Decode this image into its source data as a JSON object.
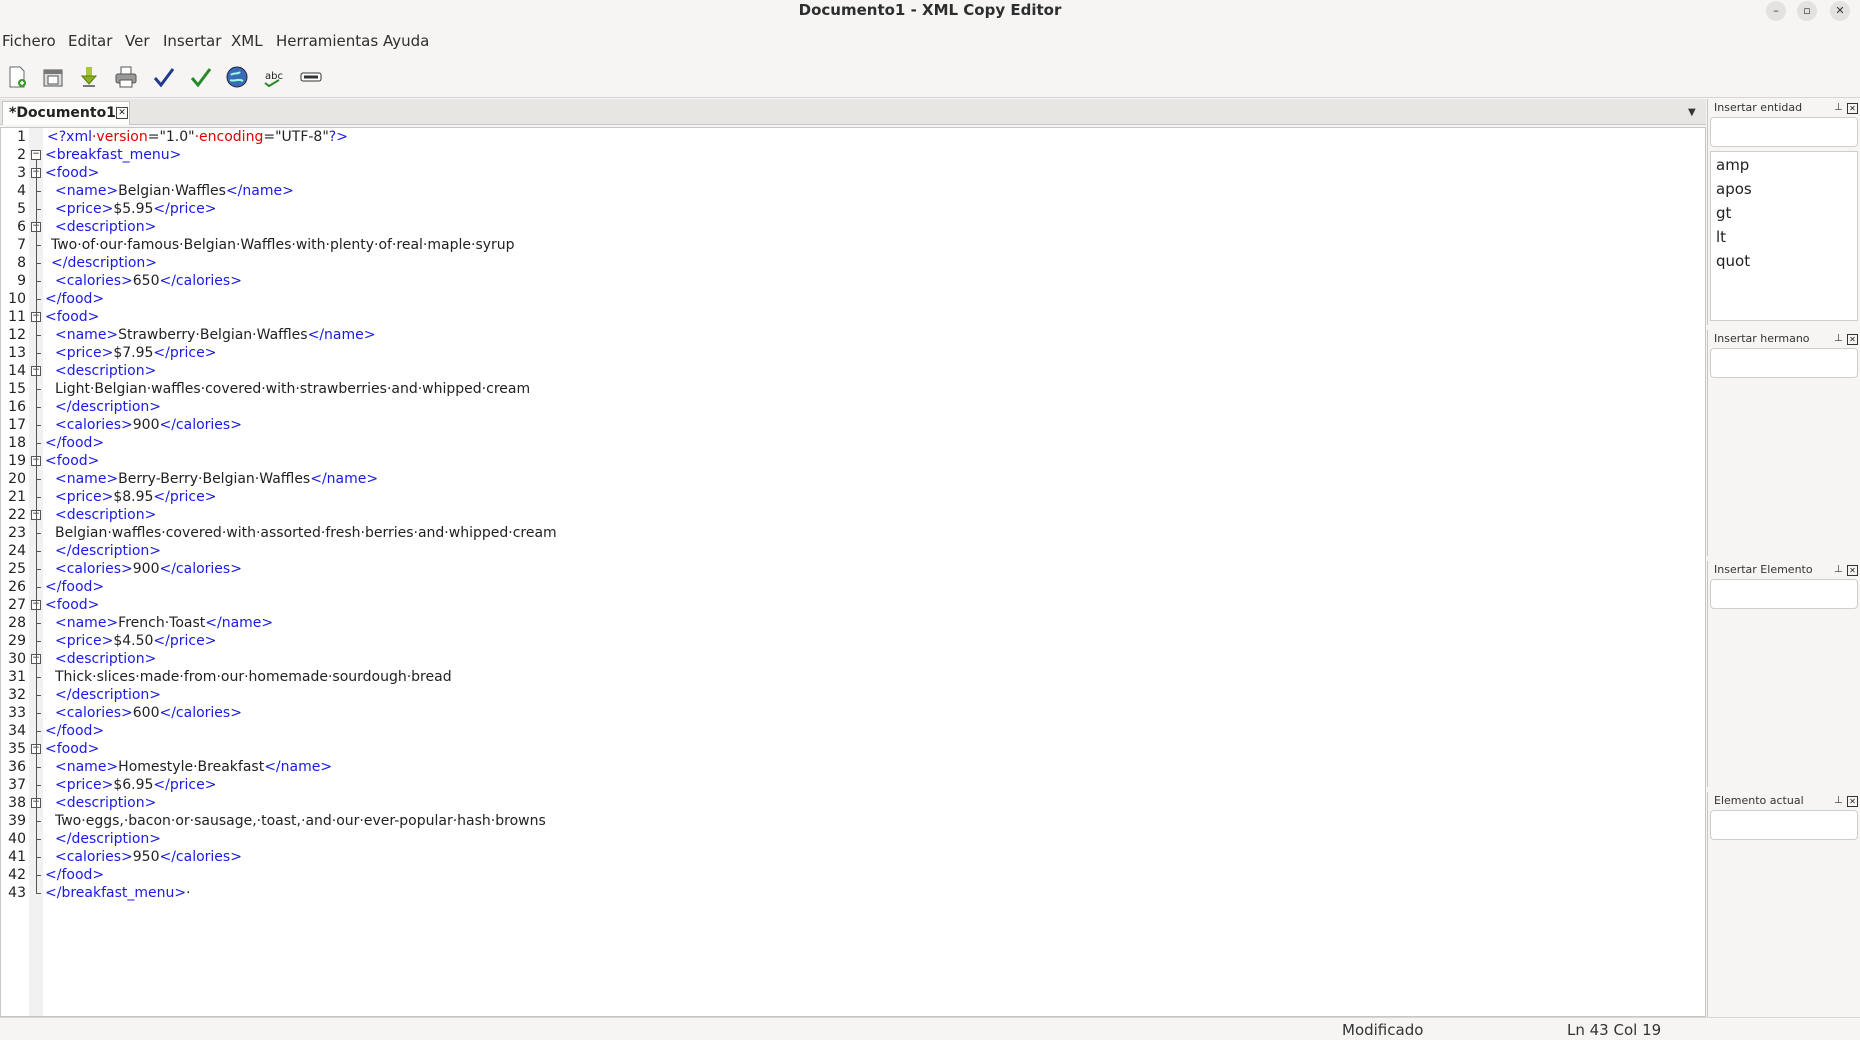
{
  "window": {
    "title": "Documento1 - XML Copy Editor"
  },
  "menubar": [
    "Fichero",
    "Editar",
    "Ver",
    "Insertar",
    "XML",
    "Herramientas",
    "Ayuda"
  ],
  "toolbar": [
    "new-document-icon",
    "open-icon",
    "save-icon",
    "print-icon",
    "check-wellformed-icon",
    "validate-icon",
    "browser-preview-icon",
    "spelling-icon",
    "hide-tags-icon"
  ],
  "tab": {
    "label": "*Documento1"
  },
  "editor": {
    "lines": [
      "<?xml version=\"1.0\" encoding=\"UTF-8\"?>",
      "<breakfast_menu>",
      "<food>",
      "<name>Belgian·Waffles</name>",
      "<price>$5.95</price>",
      "<description>",
      "Two·of·our·famous·Belgian·Waffles·with·plenty·of·real·maple·syrup",
      "</description>",
      "<calories>650</calories>",
      "</food>",
      "<food>",
      "<name>Strawberry·Belgian·Waffles</name>",
      "<price>$7.95</price>",
      "<description>",
      "Light·Belgian·waffles·covered·with·strawberries·and·whipped·cream",
      "</description>",
      "<calories>900</calories>",
      "</food>",
      "<food>",
      "<name>Berry-Berry·Belgian·Waffles</name>",
      "<price>$8.95</price>",
      "<description>",
      "Belgian·waffles·covered·with·assorted·fresh·berries·and·whipped·cream",
      "</description>",
      "<calories>900</calories>",
      "</food>",
      "<food>",
      "<name>French·Toast</name>",
      "<price>$4.50</price>",
      "<description>",
      "Thick·slices·made·from·our·homemade·sourdough·bread",
      "</description>",
      "<calories>600</calories>",
      "</food>",
      "<food>",
      "<name>Homestyle·Breakfast</name>",
      "<price>$6.95</price>",
      "<description>",
      "Two·eggs,·bacon·or·sausage,·toast,·and·our·ever-popular·hash·browns",
      "</description>",
      "<calories>950</calories>",
      "</food>",
      "</breakfast_menu>·"
    ]
  },
  "panes": {
    "entity": {
      "title": "Insertar entidad",
      "items": [
        "amp",
        "apos",
        "gt",
        "lt",
        "quot"
      ]
    },
    "sibling": {
      "title": "Insertar hermano"
    },
    "element": {
      "title": "Insertar Elemento"
    },
    "current": {
      "title": "Elemento actual"
    }
  },
  "status": {
    "state": "Modificado",
    "position": "Ln 43 Col 19"
  }
}
